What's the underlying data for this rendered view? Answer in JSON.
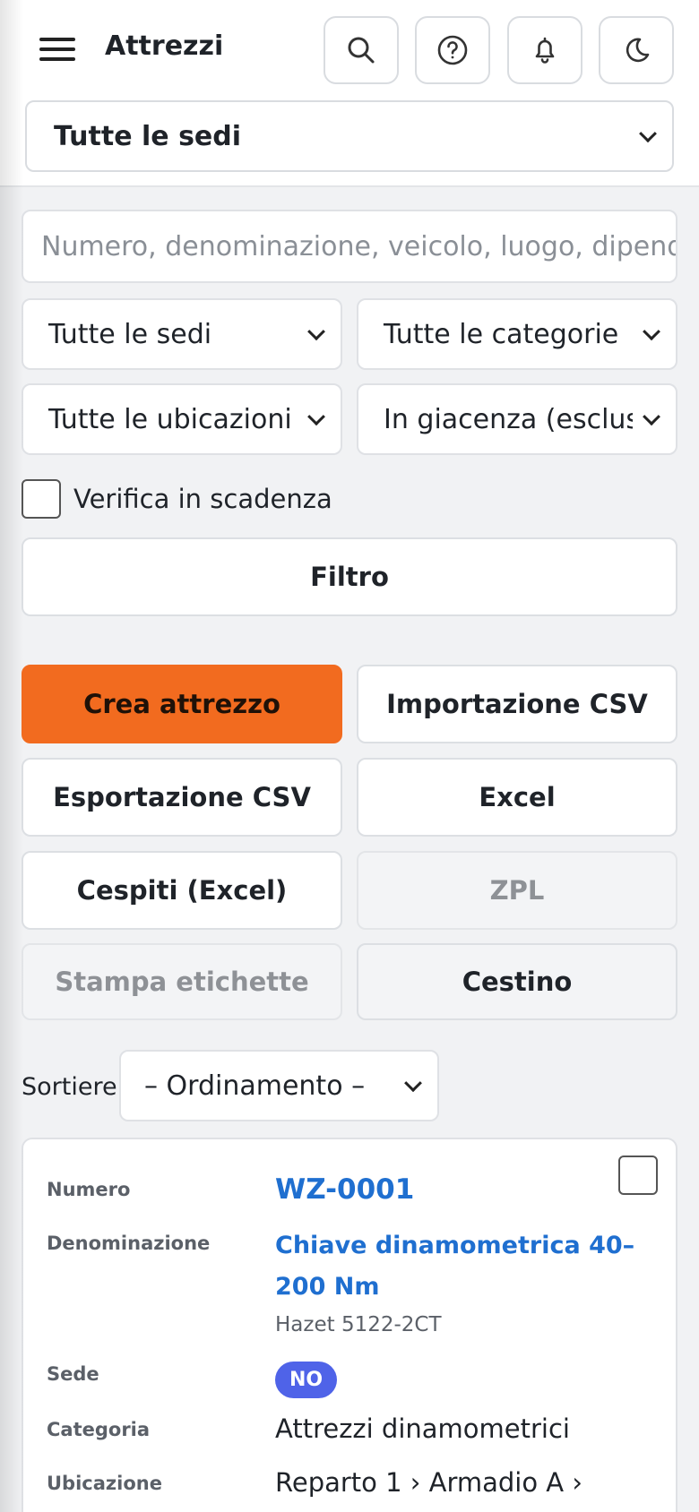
{
  "header": {
    "title": "Attrezzi",
    "site_select": "Tutte le sedi"
  },
  "filters": {
    "search_placeholder": "Numero, denominazione, veicolo, luogo, dipend",
    "site": "Tutte le sedi",
    "category": "Tutte le categorie",
    "location": "Tutte le ubicazioni",
    "stock_status": "In giacenza (esclusi",
    "verify_label": "Verifica in scadenza",
    "filter_button": "Filtro"
  },
  "actions": {
    "create": "Crea attrezzo",
    "import_csv": "Importazione CSV",
    "export_csv": "Esportazione CSV",
    "excel": "Excel",
    "assets_excel": "Cespiti (Excel)",
    "zpl": "ZPL",
    "print_labels": "Stampa etichette",
    "trash": "Cestino"
  },
  "sort": {
    "label": "Sortieren",
    "value": "– Ordinamento –"
  },
  "card": {
    "number_label": "Numero",
    "number": "WZ-0001",
    "name_label": "Denominazione",
    "name": "Chiave dinamometrica 40–200 Nm",
    "model": "Hazet 5122-2CT",
    "site_label": "Sede",
    "site_badge": "NO",
    "category_label": "Categoria",
    "category": "Attrezzi dinamometrici",
    "location_label": "Ubicazione",
    "location": "Reparto 1 › Armadio A ›"
  },
  "colors": {
    "accent": "#f26b1f",
    "link": "#1f6fd0",
    "badge": "#4f63e8"
  },
  "icons": [
    "menu-icon",
    "search-icon",
    "help-icon",
    "bell-icon",
    "moon-icon",
    "chevron-down-icon"
  ]
}
